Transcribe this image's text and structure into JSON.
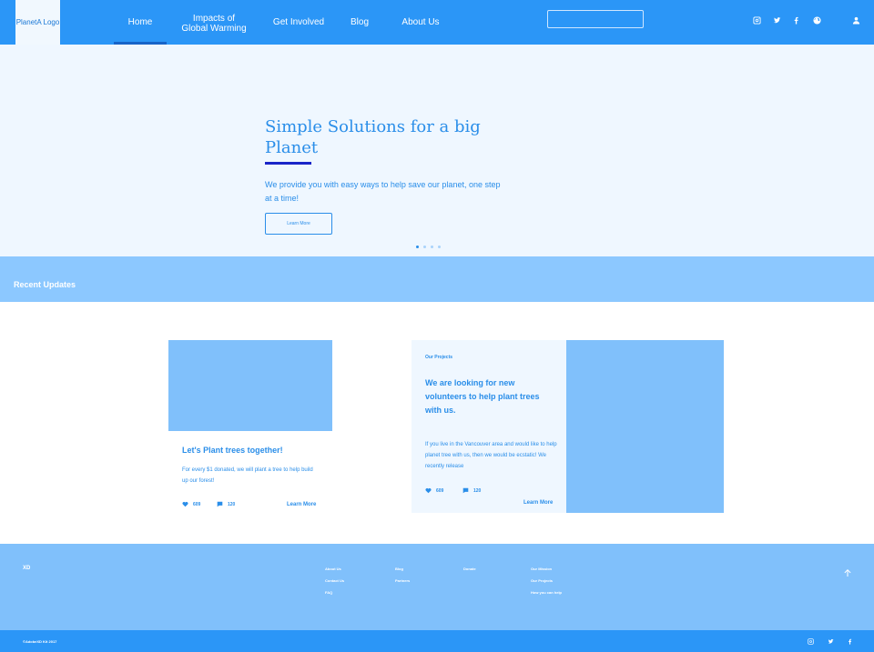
{
  "header": {
    "logo": "PlanetA Logo",
    "nav": [
      {
        "label": "Home"
      },
      {
        "label": "Impacts of Global Warming"
      },
      {
        "label": "Get Involved"
      },
      {
        "label": "Blog"
      },
      {
        "label": "About Us"
      }
    ],
    "search_value": ""
  },
  "hero": {
    "title": "Simple Solutions for a big Planet",
    "description": "We provide you with easy ways to help save our planet, one step at a time!",
    "button": "Learn More",
    "slides": 4,
    "active_slide": 1
  },
  "recent": {
    "title": "Recent Updates"
  },
  "card1": {
    "title": "Let's Plant trees together!",
    "text": "For every $1 donated, we will plant a tree to help build up our forest!",
    "likes": "609",
    "comments": "120",
    "link": "Learn More"
  },
  "card2": {
    "category": "Our Projects",
    "title": "We are looking for new volunteers to help plant trees with us.",
    "text": "If you live in the Vancouver area and would like to help planet tree with us, then we would be ecstatic! We recently release",
    "likes": "609",
    "comments": "120",
    "link": "Learn More"
  },
  "footer": {
    "brand": "XD",
    "col1": [
      "About Us",
      "Contact Us",
      "FAQ"
    ],
    "col2": [
      "Blog",
      "Partners"
    ],
    "col3": [
      "Donate"
    ],
    "col4": [
      "Our Mission",
      "Our Projects",
      "How you can help"
    ],
    "copyright": "©AdobeXD Kit 2017"
  },
  "colors": {
    "primary": "#2b96f7",
    "light": "#eff7ff",
    "band": "#8cc8ff",
    "placeholder": "#80c0fb",
    "accent_underline": "#1a25c8"
  }
}
